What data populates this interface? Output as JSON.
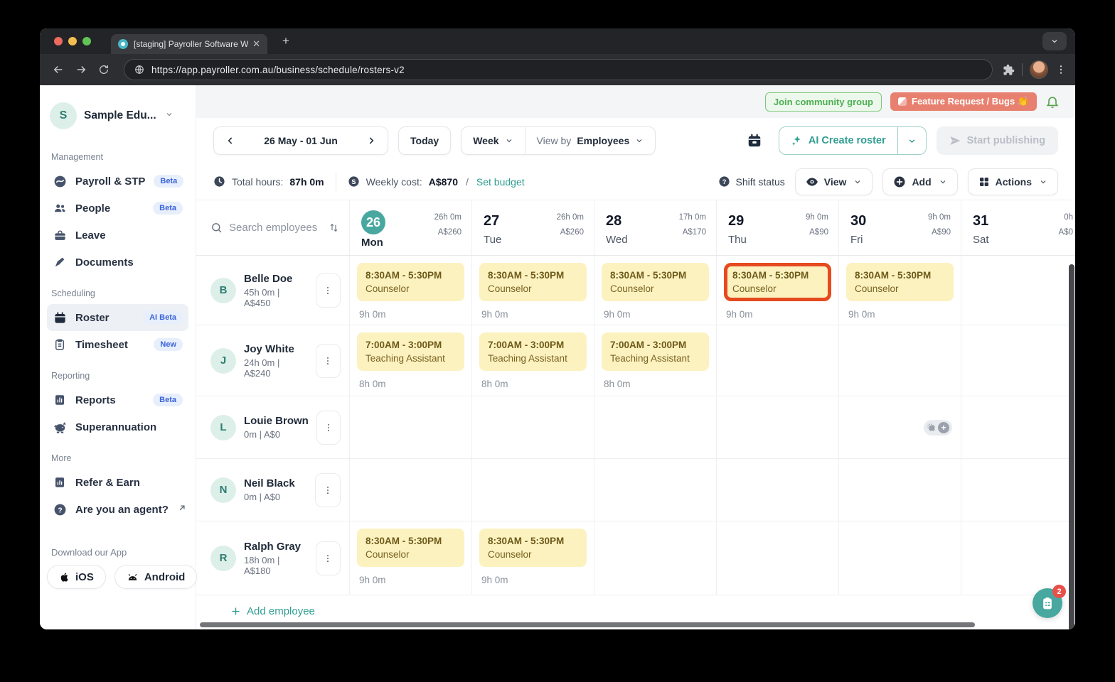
{
  "browser": {
    "tab_title": "[staging] Payroller Software W",
    "url": "https://app.payroller.com.au/business/schedule/rosters-v2"
  },
  "sidebar": {
    "org_initial": "S",
    "org_name": "Sample Edu...",
    "sections": [
      {
        "label": "Management",
        "items": [
          {
            "id": "payroll",
            "icon": "payroll-icon",
            "label": "Payroll & STP",
            "badge": "Beta"
          },
          {
            "id": "people",
            "icon": "people-icon",
            "label": "People",
            "badge": "Beta"
          },
          {
            "id": "leave",
            "icon": "leave-icon",
            "label": "Leave"
          },
          {
            "id": "documents",
            "icon": "documents-icon",
            "label": "Documents"
          }
        ]
      },
      {
        "label": "Scheduling",
        "items": [
          {
            "id": "roster",
            "icon": "roster-icon",
            "label": "Roster",
            "badge": "AI Beta",
            "active": true
          },
          {
            "id": "timesheet",
            "icon": "timesheet-icon",
            "label": "Timesheet",
            "badge": "New"
          }
        ]
      },
      {
        "label": "Reporting",
        "items": [
          {
            "id": "reports",
            "icon": "reports-icon",
            "label": "Reports",
            "badge": "Beta"
          },
          {
            "id": "superannuation",
            "icon": "superannuation-icon",
            "label": "Superannuation"
          }
        ]
      },
      {
        "label": "More",
        "items": [
          {
            "id": "refer-earn",
            "icon": "refer-icon",
            "label": "Refer & Earn"
          },
          {
            "id": "agent",
            "icon": "agent-icon",
            "label": "Are you an agent?",
            "external": true
          }
        ]
      }
    ],
    "download_label": "Download our App",
    "ios_label": "iOS",
    "android_label": "Android"
  },
  "header": {
    "join_community": "Join community group",
    "feature_request": "Feature Request / Bugs 👏"
  },
  "toolbar": {
    "date_range": "26 May - 01 Jun",
    "today": "Today",
    "week": "Week",
    "view_by": "View by",
    "view_by_value": "Employees",
    "ai_create": "AI Create roster",
    "start_publishing": "Start publishing"
  },
  "stats": {
    "total_hours_label": "Total hours:",
    "total_hours": "87h 0m",
    "weekly_cost_label": "Weekly cost:",
    "weekly_cost": "A$870",
    "slash": "/",
    "set_budget": "Set budget",
    "shift_status": "Shift status",
    "view": "View",
    "add": "Add",
    "actions": "Actions"
  },
  "calendar": {
    "search_placeholder": "Search employees",
    "days": [
      {
        "date": "26",
        "name": "Mon",
        "hours": "26h 0m",
        "cost": "A$260",
        "today": true
      },
      {
        "date": "27",
        "name": "Tue",
        "hours": "26h 0m",
        "cost": "A$260"
      },
      {
        "date": "28",
        "name": "Wed",
        "hours": "17h 0m",
        "cost": "A$170"
      },
      {
        "date": "29",
        "name": "Thu",
        "hours": "9h 0m",
        "cost": "A$90"
      },
      {
        "date": "30",
        "name": "Fri",
        "hours": "9h 0m",
        "cost": "A$90"
      },
      {
        "date": "31",
        "name": "Sat",
        "hours": "0h",
        "cost": "A$0"
      }
    ],
    "employees": [
      {
        "initial": "B",
        "name": "Belle Doe",
        "summary": "45h 0m | A$450",
        "cells": [
          {
            "shift": {
              "time": "8:30AM - 5:30PM",
              "role": "Counselor"
            },
            "hours": "9h 0m"
          },
          {
            "shift": {
              "time": "8:30AM - 5:30PM",
              "role": "Counselor"
            },
            "hours": "9h 0m"
          },
          {
            "shift": {
              "time": "8:30AM - 5:30PM",
              "role": "Counselor"
            },
            "hours": "9h 0m"
          },
          {
            "shift": {
              "time": "8:30AM - 5:30PM",
              "role": "Counselor"
            },
            "hours": "9h 0m",
            "highlighted": true
          },
          {
            "shift": {
              "time": "8:30AM - 5:30PM",
              "role": "Counselor"
            },
            "hours": "9h 0m"
          },
          {}
        ]
      },
      {
        "initial": "J",
        "name": "Joy White",
        "summary": "24h 0m | A$240",
        "cells": [
          {
            "shift": {
              "time": "7:00AM - 3:00PM",
              "role": "Teaching Assistant"
            },
            "hours": "8h 0m"
          },
          {
            "shift": {
              "time": "7:00AM - 3:00PM",
              "role": "Teaching Assistant"
            },
            "hours": "8h 0m"
          },
          {
            "shift": {
              "time": "7:00AM - 3:00PM",
              "role": "Teaching Assistant"
            },
            "hours": "8h 0m"
          },
          {},
          {},
          {}
        ]
      },
      {
        "initial": "L",
        "name": "Louie Brown",
        "summary": "0m | A$0",
        "cells": [
          {},
          {},
          {},
          {},
          {
            "hover_actions": true
          },
          {}
        ]
      },
      {
        "initial": "N",
        "name": "Neil Black",
        "summary": "0m | A$0",
        "cells": [
          {},
          {},
          {},
          {},
          {},
          {}
        ]
      },
      {
        "initial": "R",
        "name": "Ralph Gray",
        "summary": "18h 0m | A$180",
        "cells": [
          {
            "shift": {
              "time": "8:30AM - 5:30PM",
              "role": "Counselor"
            },
            "hours": "9h 0m"
          },
          {
            "shift": {
              "time": "8:30AM - 5:30PM",
              "role": "Counselor"
            },
            "hours": "9h 0m"
          },
          {},
          {},
          {},
          {}
        ]
      }
    ],
    "add_employee": "Add employee"
  },
  "floating": {
    "badge": "2"
  },
  "colors": {
    "accent_teal": "#2f9e91",
    "today_circle": "#48a8a0",
    "shift_bg": "#fcf2c0",
    "shift_text": "#6e5a19",
    "highlight_border": "#e64a1f",
    "badge_blue_bg": "#e7effc",
    "badge_blue_text": "#3c63d8",
    "feature_btn": "#e8806f",
    "join_btn_text": "#4caf50",
    "notification_red": "#e8504a"
  }
}
